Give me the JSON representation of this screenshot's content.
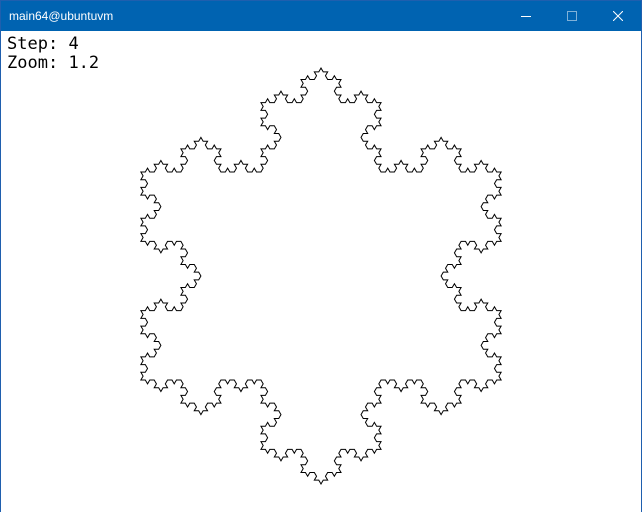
{
  "window": {
    "title": "main64@ubuntuvm",
    "titlebar_color": "#0063b1",
    "controls": {
      "minimize_icon": "minimize-icon",
      "maximize_icon": "maximize-icon",
      "close_icon": "close-icon"
    }
  },
  "hud": {
    "step_label": "Step:",
    "step_value": "4",
    "zoom_label": "Zoom:",
    "zoom_value": "1.2"
  },
  "fractal": {
    "type": "koch-snowflake",
    "iterations": 4,
    "stroke_color": "#000000",
    "fill_color": "#ffffff"
  }
}
